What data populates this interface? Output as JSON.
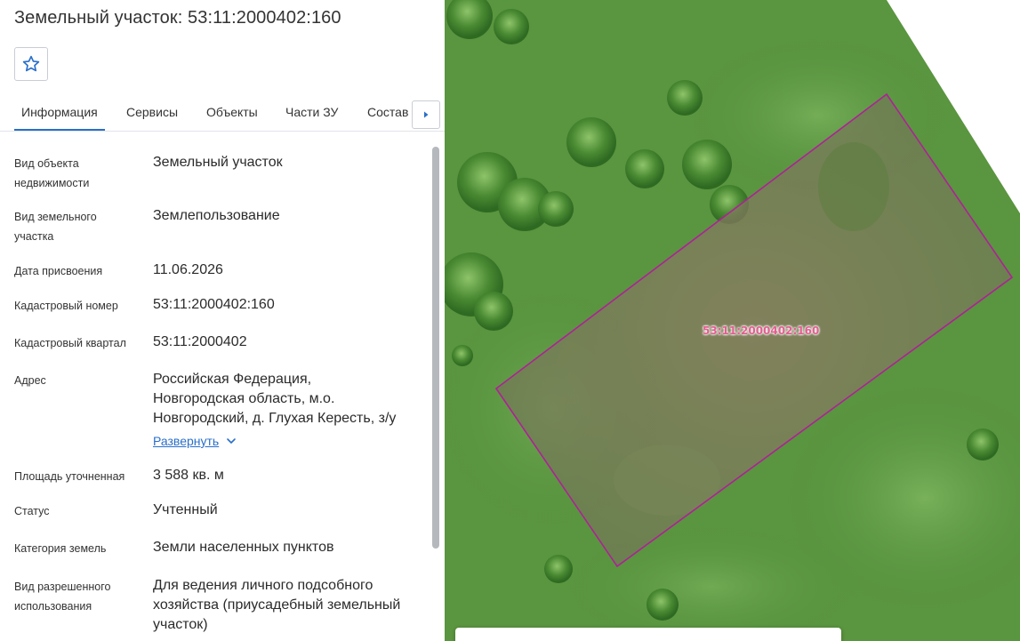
{
  "header": {
    "title": "Земельный участок: 53:11:2000402:160"
  },
  "tabs": [
    {
      "label": "Информация",
      "active": true
    },
    {
      "label": "Сервисы",
      "active": false
    },
    {
      "label": "Объекты",
      "active": false
    },
    {
      "label": "Части ЗУ",
      "active": false
    },
    {
      "label": "Состав",
      "active": false
    }
  ],
  "icons": {
    "favorite": "star-icon",
    "tabs_next": "caret-right-icon",
    "expand_chevron": "chevron-down-icon"
  },
  "info": {
    "object_type_label": "Вид объекта недвижимости",
    "object_type_value": "Земельный участок",
    "land_type_label": "Вид земельного участка",
    "land_type_value": "Землепользование",
    "assign_date_label": "Дата присвоения",
    "assign_date_value": "11.06.2026",
    "cadastral_number_label": "Кадастровый номер",
    "cadastral_number_value": "53:11:2000402:160",
    "cadastral_block_label": "Кадастровый квартал",
    "cadastral_block_value": "53:11:2000402",
    "address_label": "Адрес",
    "address_line1": "Российская Федерация,",
    "address_line2": "Новгородская область, м.о.",
    "address_line3": "Новгородский, д. Глухая Кересть, з/у",
    "expand_label": "Развернуть",
    "area_label": "Площадь уточненная",
    "area_value": "3 588 кв. м",
    "status_label": "Статус",
    "status_value": "Учтенный",
    "category_label": "Категория земель",
    "category_value": "Земли населенных пунктов",
    "permitted_use_label": "Вид разрешенного использования",
    "permitted_use_line1": "Для ведения личного подсобного",
    "permitted_use_line2": "хозяйства (приусадебный земельный",
    "permitted_use_line3": "участок)"
  },
  "map": {
    "parcel_label": "53:11:2000402:160",
    "parcel_outline_color": "#b0209a",
    "accent_color": "#2a6fc9"
  }
}
